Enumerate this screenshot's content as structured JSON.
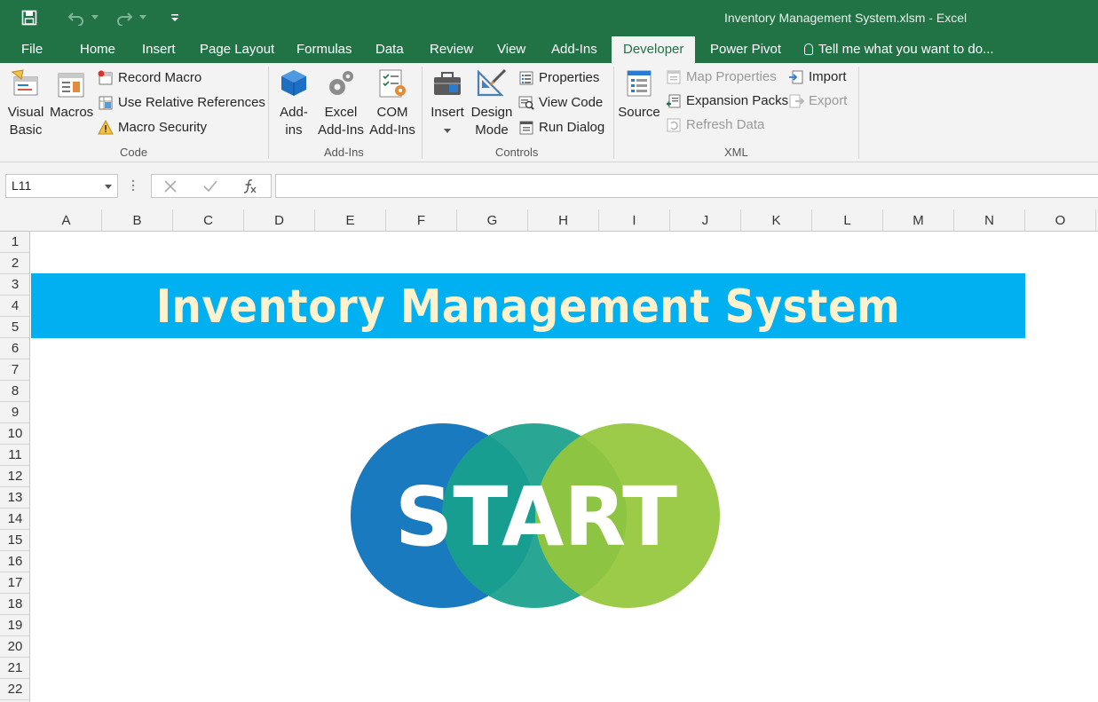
{
  "window": {
    "title": "Inventory Management System.xlsm - Excel"
  },
  "tabs": [
    "File",
    "Home",
    "Insert",
    "Page Layout",
    "Formulas",
    "Data",
    "Review",
    "View",
    "Add-Ins",
    "Developer",
    "Power Pivot"
  ],
  "tell_me": "Tell me what you want to do...",
  "ribbon": {
    "code": {
      "label": "Code",
      "visual_basic": [
        "Visual",
        "Basic"
      ],
      "macros": "Macros",
      "record_macro": "Record Macro",
      "use_relative_references": "Use Relative References",
      "macro_security": "Macro Security"
    },
    "addins": {
      "label": "Add-Ins",
      "addins": [
        "Add-",
        "ins"
      ],
      "excel_addins": [
        "Excel",
        "Add-Ins"
      ],
      "com_addins": [
        "COM",
        "Add-Ins"
      ]
    },
    "controls": {
      "label": "Controls",
      "insert": "Insert",
      "design_mode": [
        "Design",
        "Mode"
      ],
      "properties": "Properties",
      "view_code": "View Code",
      "run_dialog": "Run Dialog"
    },
    "xml": {
      "label": "XML",
      "source": "Source",
      "map_properties": "Map Properties",
      "expansion_packs": "Expansion Packs",
      "refresh_data": "Refresh Data",
      "import": "Import",
      "export": "Export"
    }
  },
  "formula_bar": {
    "name_box": "L11",
    "formula": ""
  },
  "columns": [
    "A",
    "B",
    "C",
    "D",
    "E",
    "F",
    "G",
    "H",
    "I",
    "J",
    "K",
    "L",
    "M",
    "N",
    "O"
  ],
  "rows": [
    "1",
    "2",
    "3",
    "4",
    "5",
    "6",
    "7",
    "8",
    "9",
    "10",
    "11",
    "12",
    "13",
    "14",
    "15",
    "16",
    "17",
    "18",
    "19",
    "20",
    "21",
    "22"
  ],
  "sheet": {
    "banner_title": "Inventory Management System",
    "start_button": "START"
  },
  "colors": {
    "excel_green": "#217346",
    "banner_bg": "#00b0f0",
    "banner_text": "#fff2cc",
    "circle_blue": "#1a7ac0",
    "circle_teal": "#19a08c",
    "circle_green": "#95c73c"
  }
}
